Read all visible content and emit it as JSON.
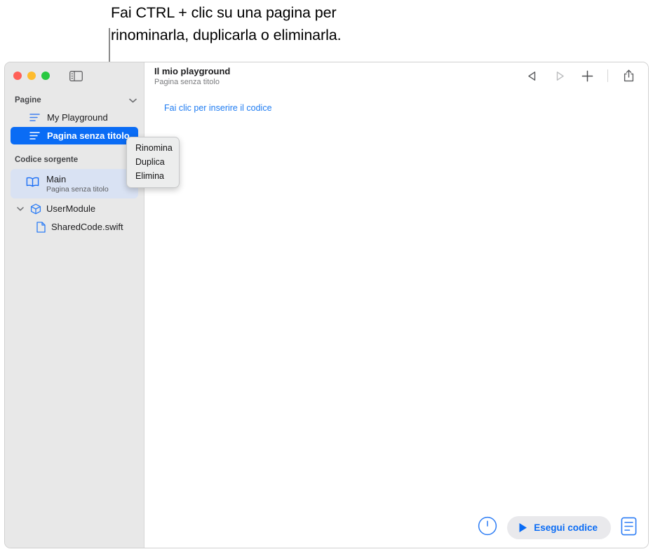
{
  "annotation": {
    "line1": "Fai CTRL + clic su una pagina per",
    "line2": "rinominarla, duplicarla o eliminarla."
  },
  "window": {
    "traffic_lights": [
      "close-red",
      "minimize-yellow",
      "zoom-green"
    ],
    "sidebar_toggle_label": "sidebar-toggle"
  },
  "sidebar": {
    "sections": [
      {
        "title": "Pagine",
        "collapse_chevron": "chevron-down",
        "items": [
          {
            "label": "My Playground",
            "icon": "page-lines-icon",
            "selected": false
          },
          {
            "label": "Pagina senza titolo",
            "icon": "page-lines-icon",
            "selected": true
          }
        ]
      },
      {
        "title": "Codice sorgente",
        "items": [
          {
            "label": "Main",
            "sublabel": "Pagina senza titolo",
            "icon": "book-icon",
            "selected": true
          },
          {
            "label": "UserModule",
            "icon": "module-cube-icon",
            "disclosure": "chevron-down"
          },
          {
            "label": "SharedCode.swift",
            "icon": "swift-file-icon"
          }
        ]
      }
    ]
  },
  "context_menu": {
    "items": [
      "Rinomina",
      "Duplica",
      "Elimina"
    ]
  },
  "content": {
    "doc_title": "Il mio playground",
    "doc_subtitle": "Pagina senza titolo",
    "code_hint": "Fai clic per inserire il codice",
    "toolbar": {
      "back": "back-triangle-icon",
      "forward": "forward-triangle-icon",
      "add": "plus-icon",
      "share": "share-icon"
    }
  },
  "bottom_bar": {
    "gauge_label": "speed-gauge-icon",
    "run_label": "Esegui codice",
    "console_label": "console-icon"
  },
  "colors": {
    "accent_blue": "#0a6cf5",
    "link_blue": "#1f7cf2",
    "sidebar_bg": "#e8e8e8",
    "selection_soft": "#d9e2f3"
  }
}
